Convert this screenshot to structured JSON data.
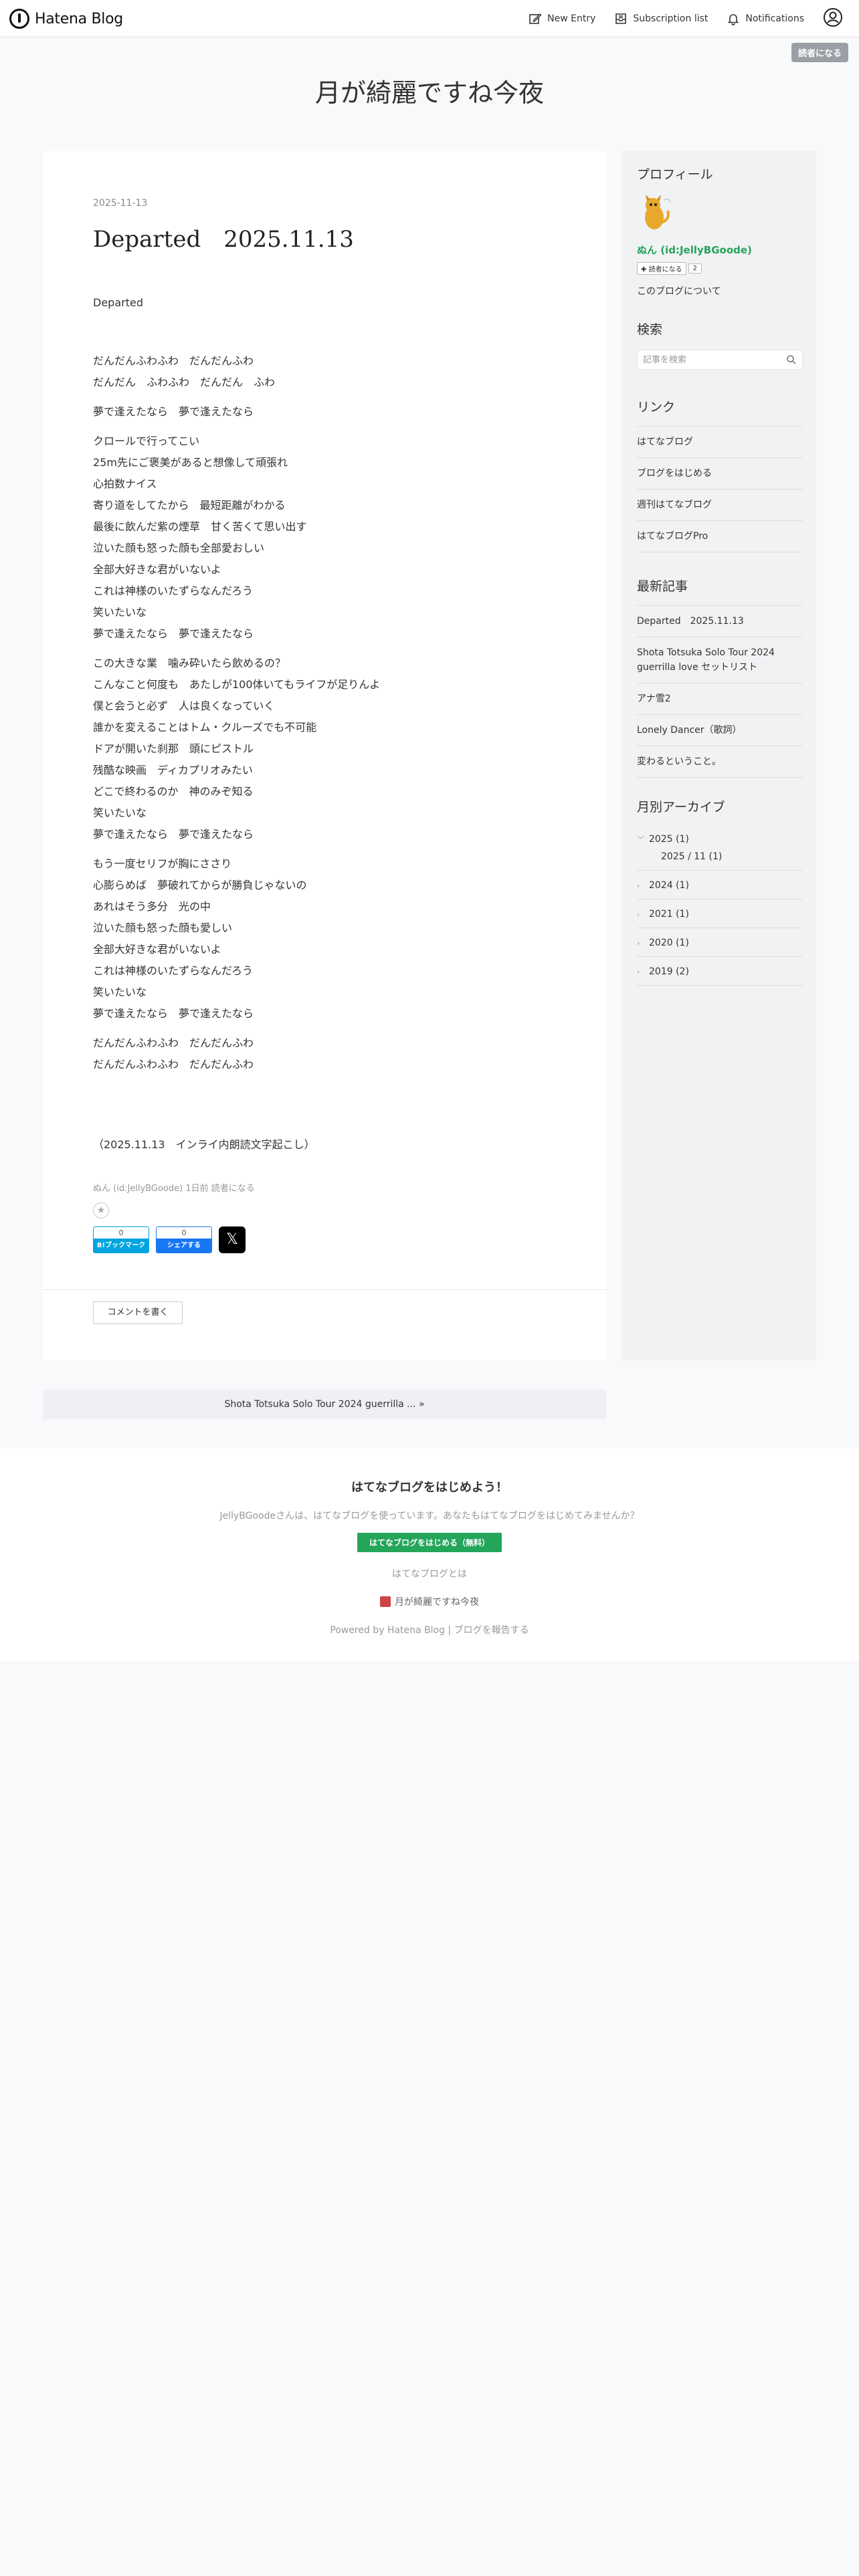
{
  "header": {
    "logo_text": "Hatena Blog",
    "nav": [
      {
        "label": "New Entry",
        "icon": "edit-icon"
      },
      {
        "label": "Subscription list",
        "icon": "inbox-icon"
      },
      {
        "label": "Notifications",
        "icon": "bell-icon"
      }
    ],
    "reader_badge": "読者になる"
  },
  "blog": {
    "title": "月が綺麗ですね今夜"
  },
  "entry": {
    "date": "2025-11-13",
    "title": "Departed　2025.11.13",
    "lead": "Departed",
    "paragraphs": [
      [
        "だんだんふわふわ　だんだんふわ",
        "だんだん　ふわふわ　だんだん　ふわ"
      ],
      [
        "夢で逢えたなら　夢で逢えたなら"
      ],
      [
        "クロールで行ってこい",
        "25m先にご褒美があると想像して頑張れ",
        "心拍数ナイス",
        "寄り道をしてたから　最短距離がわかる",
        "最後に飲んだ紫の煙草　甘く苦くて思い出す",
        "泣いた顔も怒った顔も全部愛おしい",
        "全部大好きな君がいないよ",
        "これは神様のいたずらなんだろう",
        "笑いたいな",
        "夢で逢えたなら　夢で逢えたなら"
      ],
      [
        "この大きな業　噛み砕いたら飲めるの？",
        "こんなこと何度も　あたしが100体いてもライフが足りんよ",
        "僕と会うと必ず　人は良くなっていく",
        "誰かを変えることはトム・クルーズでも不可能",
        "ドアが開いた刹那　頭にピストル",
        "残酷な映画　ディカプリオみたい",
        "どこで終わるのか　神のみぞ知る",
        "笑いたいな",
        "夢で逢えたなら　夢で逢えたなら"
      ],
      [
        "もう一度セリフが胸にささり",
        "心膨らめば　夢破れてからが勝負じゃないの",
        "あれはそう多分　光の中",
        "泣いた顔も怒った顔も愛しい",
        "全部大好きな君がいないよ",
        "これは神様のいたずらなんだろう",
        "笑いたいな",
        "夢で逢えたなら　夢で逢えたなら"
      ],
      [
        "だんだんふわふわ　だんだんふわ",
        "だんだんふわふわ　だんだんふわ"
      ]
    ],
    "closing": "（2025.11.13　インライ内朗読文字起こし）",
    "footer_author": "ぬん (id:JellyBGoode)",
    "footer_time": "1日前",
    "footer_subscribe": "読者になる",
    "hatena_count": "0",
    "hatena_label": "B!ブックマーク",
    "fb_count": "0",
    "fb_label": "シェアする",
    "x_label": "𝕏",
    "comment_label": "コメントを書く"
  },
  "pager": {
    "next": "Shota Totsuka Solo Tour 2024 guerrilla ... »"
  },
  "sidebar": {
    "profile": {
      "title": "プロフィール",
      "username": "ぬん (id:JellyBGoode)",
      "subscribe": "読者になる",
      "count": "2",
      "about": "このブログについて"
    },
    "search": {
      "title": "検索",
      "placeholder": "記事を検索"
    },
    "links": {
      "title": "リンク",
      "items": [
        "はてなブログ",
        "ブログをはじめる",
        "週刊はてなブログ",
        "はてなブログPro"
      ]
    },
    "recent": {
      "title": "最新記事",
      "items": [
        "Departed　2025.11.13",
        "Shota Totsuka Solo Tour 2024 guerrilla love セットリスト",
        "アナ雪2",
        "Lonely Dancer（歌詞）",
        "変わるということ。"
      ]
    },
    "archive": {
      "title": "月別アーカイブ",
      "years": [
        "2025 (1)",
        "2024 (1)",
        "2021 (1)",
        "2020 (1)",
        "2019 (2)"
      ],
      "month": "2025 / 11 (1)"
    }
  },
  "promo": {
    "title": "はてなブログをはじめよう！",
    "desc": "JellyBGoodeさんは、はてなブログを使っています。あなたもはてなブログをはじめてみませんか？",
    "button": "はてなブログをはじめる（無料）",
    "about": "はてなブログとは",
    "blog_name": "月が綺麗ですね今夜",
    "powered": "Powered by Hatena Blog | ブログを報告する"
  },
  "colors": {
    "accent_green": "#23a55a",
    "hatena_blue": "#00a4de",
    "facebook_blue": "#1877f2"
  }
}
